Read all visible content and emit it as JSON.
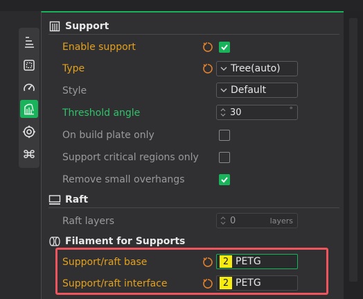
{
  "colors": {
    "accent": "#19b35c",
    "modified": "#e4a11b",
    "highlight": "#f0545d",
    "filament_badge": "#f5eb0e"
  },
  "sidebar": {
    "items": [
      {
        "icon": "layers-icon"
      },
      {
        "icon": "frame-icon"
      },
      {
        "icon": "speed-gauge-icon"
      },
      {
        "icon": "support-icon",
        "active": true
      },
      {
        "icon": "target-icon"
      },
      {
        "icon": "others-icon"
      }
    ]
  },
  "support": {
    "title": "Support",
    "enable_support": {
      "label": "Enable support",
      "checked": true
    },
    "type": {
      "label": "Type",
      "value": "Tree(auto)"
    },
    "style": {
      "label": "Style",
      "value": "Default"
    },
    "threshold_angle": {
      "label": "Threshold angle",
      "value": "30",
      "unit": "°"
    },
    "on_build_plate_only": {
      "label": "On build plate only",
      "checked": false
    },
    "critical_regions_only": {
      "label": "Support critical regions only",
      "checked": false
    },
    "remove_small_overhangs": {
      "label": "Remove small overhangs",
      "checked": true
    }
  },
  "raft": {
    "title": "Raft",
    "raft_layers": {
      "label": "Raft layers",
      "value": "0",
      "unit": "layers"
    }
  },
  "filament": {
    "title": "Filament for Supports",
    "base": {
      "label": "Support/raft base",
      "slot": "2",
      "name": "PETG"
    },
    "interface": {
      "label": "Support/raft interface",
      "slot": "2",
      "name": "PETG"
    }
  }
}
